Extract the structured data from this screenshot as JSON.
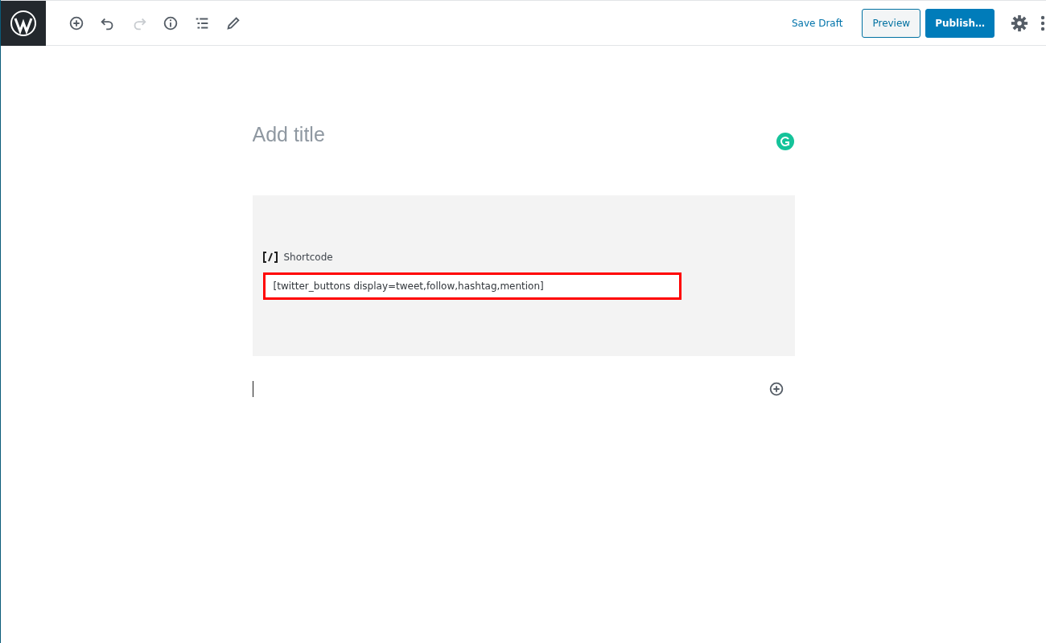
{
  "toolbar": [
    {
      "kind": "add",
      "disabled": false
    },
    {
      "kind": "undo",
      "disabled": false
    },
    {
      "kind": "redo",
      "disabled": true
    },
    {
      "kind": "info",
      "disabled": false
    },
    {
      "kind": "outline",
      "disabled": false
    },
    {
      "kind": "edit",
      "disabled": false
    }
  ],
  "actions": {
    "save_draft": "Save Draft",
    "preview": "Preview",
    "publish": "Publish…"
  },
  "title": {
    "placeholder": "Add title"
  },
  "shortcode_block": {
    "label": "Shortcode",
    "value": "[twitter_buttons display=tweet,follow,hashtag,mention]",
    "highlighted": true
  }
}
